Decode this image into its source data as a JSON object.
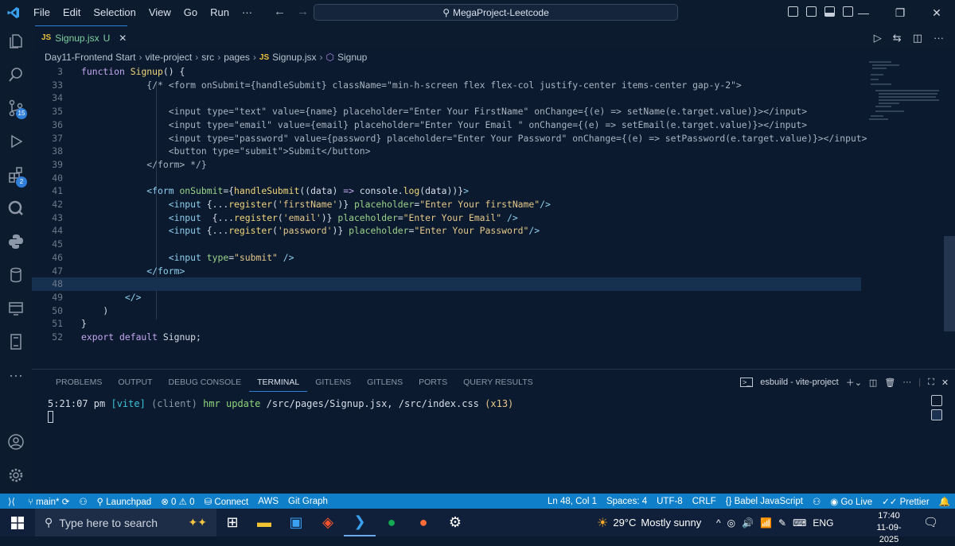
{
  "menu": [
    "File",
    "Edit",
    "Selection",
    "View",
    "Go",
    "Run",
    "···"
  ],
  "search": {
    "text": "MegaProject-Leetcode"
  },
  "tab": {
    "lang": "JS",
    "name": "Signup.jsx",
    "status": "U"
  },
  "breadcrumb": [
    "Day11-Frontend Start",
    "vite-project",
    "src",
    "pages",
    "Signup.jsx",
    "Signup"
  ],
  "breadcrumb_js": "JS",
  "activity": {
    "scm_badge": "15",
    "ext_badge": "2"
  },
  "code": {
    "lines": [
      {
        "n": "3",
        "segs": [
          [
            "kw",
            "function "
          ],
          [
            "fn",
            "Signup"
          ],
          [
            "tx",
            "() {"
          ]
        ]
      },
      {
        "n": "33",
        "segs": [
          [
            "cm",
            "            {/* <form onSubmit={handleSubmit} className=\"min-h-screen flex flex-col justify-center items-center gap-y-2\">"
          ]
        ]
      },
      {
        "n": "34",
        "segs": []
      },
      {
        "n": "35",
        "segs": [
          [
            "cm",
            "                <input type=\"text\" value={name} placeholder=\"Enter Your FirstName\" onChange={(e) => setName(e.target.value)}></input>"
          ]
        ]
      },
      {
        "n": "36",
        "segs": [
          [
            "cm",
            "                <input type=\"email\" value={email} placeholder=\"Enter Your Email \" onChange={(e) => setEmail(e.target.value)}></input>"
          ]
        ]
      },
      {
        "n": "37",
        "segs": [
          [
            "cm",
            "                <input type=\"password\" value={password} placeholder=\"Enter Your Password\" onChange={(e) => setPassword(e.target.value)}></input>"
          ]
        ]
      },
      {
        "n": "38",
        "segs": [
          [
            "cm",
            "                <button type=\"submit\">Submit</button>"
          ]
        ]
      },
      {
        "n": "39",
        "segs": [
          [
            "cm",
            "            </form> */}"
          ]
        ]
      },
      {
        "n": "40",
        "segs": []
      },
      {
        "n": "41",
        "segs": [
          [
            "tx",
            "            "
          ],
          [
            "tg",
            "<form "
          ],
          [
            "at",
            "onSubmit"
          ],
          [
            "tx",
            "={"
          ],
          [
            "fn",
            "handleSubmit"
          ],
          [
            "tx",
            "(("
          ],
          [
            "tx",
            "data"
          ],
          [
            "tx",
            ") "
          ],
          [
            "kw",
            "=>"
          ],
          [
            "tx",
            " console."
          ],
          [
            "fn",
            "log"
          ],
          [
            "tx",
            "(data))}"
          ],
          [
            "tg",
            ">"
          ]
        ]
      },
      {
        "n": "42",
        "segs": [
          [
            "tx",
            "                "
          ],
          [
            "tg",
            "<input "
          ],
          [
            "tx",
            "{..."
          ],
          [
            "fn",
            "register"
          ],
          [
            "tx",
            "("
          ],
          [
            "st",
            "'firstName'"
          ],
          [
            "tx",
            ")} "
          ],
          [
            "at",
            "placeholder"
          ],
          [
            "tx",
            "="
          ],
          [
            "st",
            "\"Enter Your firstName\""
          ],
          [
            "tg",
            "/>"
          ]
        ]
      },
      {
        "n": "43",
        "segs": [
          [
            "tx",
            "                "
          ],
          [
            "tg",
            "<input  "
          ],
          [
            "tx",
            "{..."
          ],
          [
            "fn",
            "register"
          ],
          [
            "tx",
            "("
          ],
          [
            "st",
            "'email'"
          ],
          [
            "tx",
            ")} "
          ],
          [
            "at",
            "placeholder"
          ],
          [
            "tx",
            "="
          ],
          [
            "st",
            "\"Enter Your Email\""
          ],
          [
            "tx",
            " "
          ],
          [
            "tg",
            "/>"
          ]
        ]
      },
      {
        "n": "44",
        "segs": [
          [
            "tx",
            "                "
          ],
          [
            "tg",
            "<input "
          ],
          [
            "tx",
            "{..."
          ],
          [
            "fn",
            "register"
          ],
          [
            "tx",
            "("
          ],
          [
            "st",
            "'password'"
          ],
          [
            "tx",
            ")} "
          ],
          [
            "at",
            "placeholder"
          ],
          [
            "tx",
            "="
          ],
          [
            "st",
            "\"Enter Your Password\""
          ],
          [
            "tg",
            "/>"
          ]
        ]
      },
      {
        "n": "45",
        "segs": []
      },
      {
        "n": "46",
        "segs": [
          [
            "tx",
            "                "
          ],
          [
            "tg",
            "<input "
          ],
          [
            "at",
            "type"
          ],
          [
            "tx",
            "="
          ],
          [
            "st",
            "\"submit\""
          ],
          [
            "tx",
            " "
          ],
          [
            "tg",
            "/>"
          ]
        ]
      },
      {
        "n": "47",
        "segs": [
          [
            "tx",
            "            "
          ],
          [
            "tg",
            "</form>"
          ]
        ]
      },
      {
        "n": "48",
        "segs": []
      },
      {
        "n": "49",
        "segs": [
          [
            "tx",
            "        "
          ],
          [
            "tg",
            "</>"
          ]
        ]
      },
      {
        "n": "50",
        "segs": [
          [
            "tx",
            "    )"
          ]
        ]
      },
      {
        "n": "51",
        "segs": [
          [
            "tx",
            "}"
          ]
        ]
      },
      {
        "n": "52",
        "segs": [
          [
            "kw",
            "export default "
          ],
          [
            "tx",
            "Signup;"
          ]
        ]
      }
    ]
  },
  "panel": {
    "tabs": [
      "PROBLEMS",
      "OUTPUT",
      "DEBUG CONSOLE",
      "TERMINAL",
      "GITLENS",
      "GITLENS",
      "PORTS",
      "QUERY RESULTS"
    ],
    "active_tab": "TERMINAL",
    "terminal_name": "esbuild - vite-project",
    "term": {
      "time": "5:21:07 pm",
      "vite": "[vite]",
      "client": "(client)",
      "hmr": "hmr update",
      "files": "/src/pages/Signup.jsx, /src/index.css",
      "count": "(x13)"
    }
  },
  "status": {
    "branch": "main*",
    "launchpad": "Launchpad",
    "errors": "0",
    "warnings": "0",
    "connect": "Connect",
    "aws": "AWS",
    "gitgraph": "Git Graph",
    "position": "Ln 48, Col 1",
    "spaces": "Spaces: 4",
    "encoding": "UTF-8",
    "eol": "CRLF",
    "language": "Babel JavaScript",
    "golive": "Go Live",
    "prettier": "Prettier"
  },
  "taskbar": {
    "search_placeholder": "Type here to search",
    "temp": "29°C",
    "weather": "Mostly sunny",
    "lang": "ENG",
    "time": "17:40",
    "date": "11-09-2025"
  }
}
